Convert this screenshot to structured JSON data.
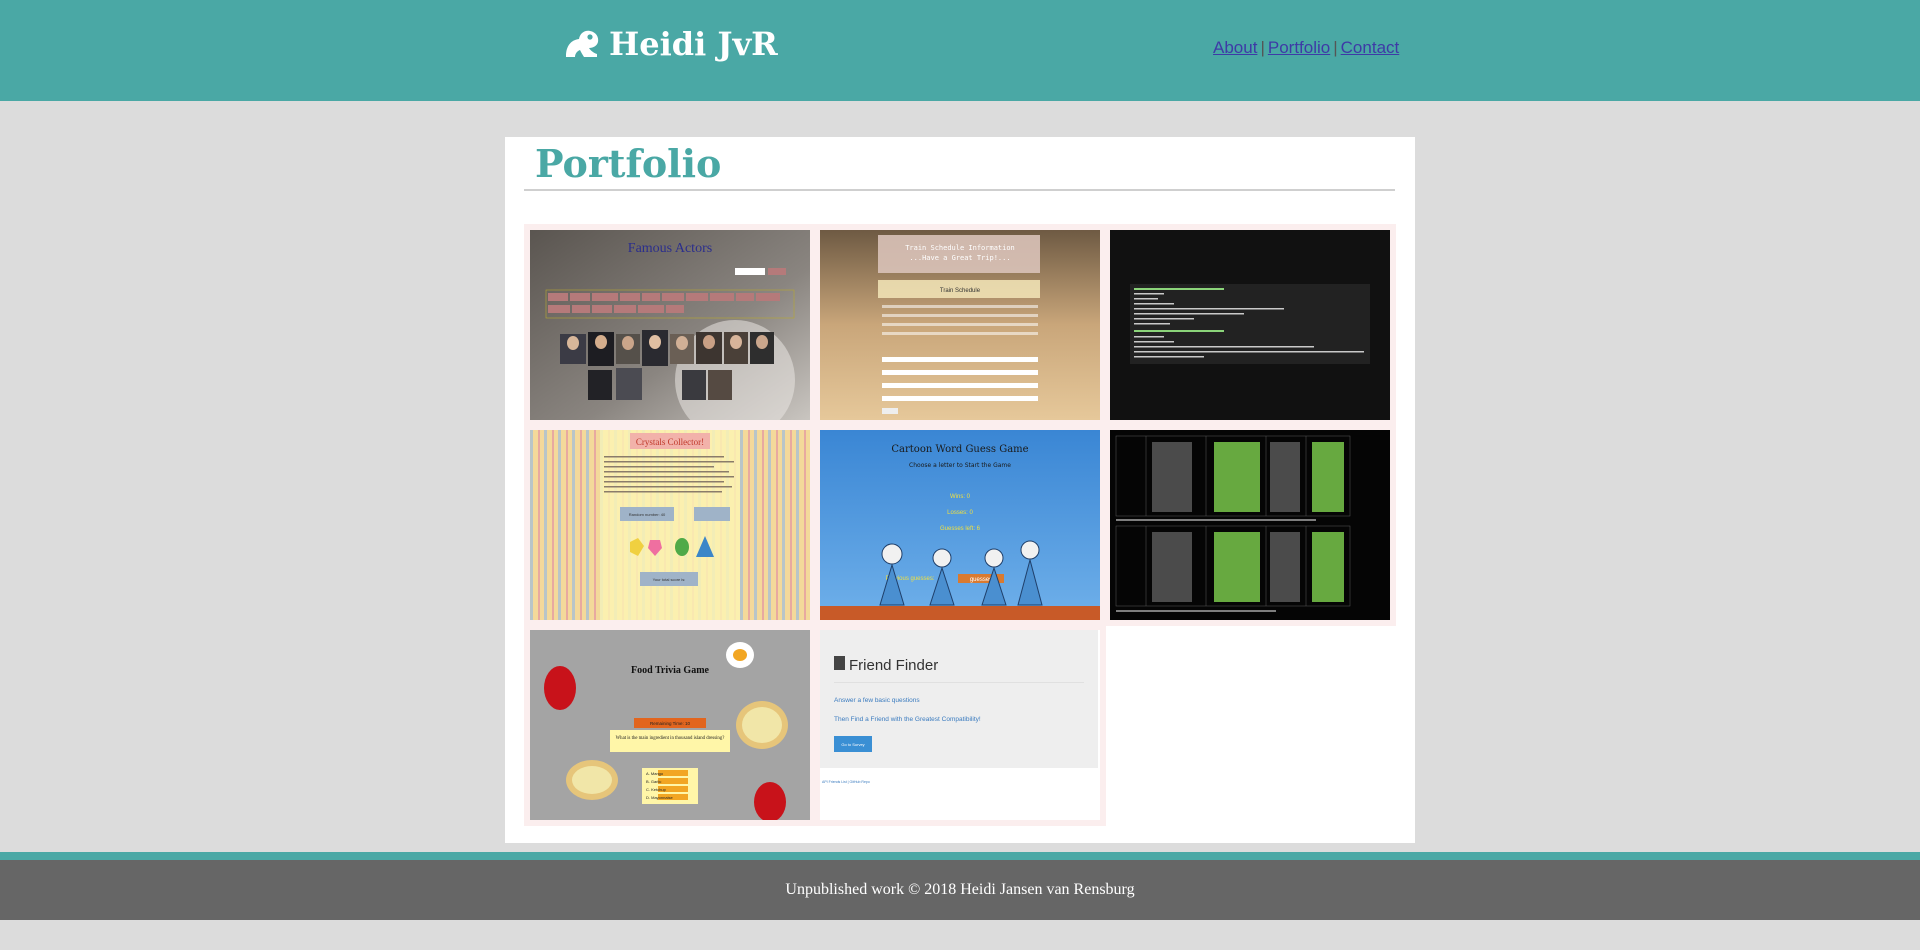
{
  "header": {
    "brand_name": "Heidi JvR",
    "brand_icon": "frog-icon",
    "nav": [
      {
        "label": "About"
      },
      {
        "label": "Portfolio"
      },
      {
        "label": "Contact"
      }
    ],
    "separator": "|"
  },
  "main": {
    "title": "Portfolio",
    "projects": [
      {
        "screenshot_text": [
          "Famous Actors"
        ]
      },
      {
        "screenshot_text": [
          "Train Schedule Information",
          "...Have a Great Trip!...",
          "Train Schedule"
        ]
      },
      {
        "screenshot_text": []
      },
      {
        "screenshot_text": [
          "Crystals Collector!",
          "Random number: 40",
          "Your total score is:"
        ]
      },
      {
        "screenshot_text": [
          "Cartoon Word Guess Game",
          "Choose a letter to Start the Game",
          "Wins: 0",
          "Losses: 0",
          "Guesses left: 6",
          "Previous guesses:",
          "guesses"
        ]
      },
      {
        "screenshot_text": []
      },
      {
        "screenshot_text": [
          "Food Trivia Game",
          "Remaining Time: 10",
          "What is the main ingredient in thousand island dressing?",
          "A. Mango",
          "B. Garlic",
          "C. Ketchup",
          "D. Mayonnaise"
        ]
      },
      {
        "screenshot_text": [
          "Friend Finder",
          "Answer a few basic questions",
          "Then Find a Friend with the Greatest Compatibility!",
          "Go to Survey",
          "API Friends List | GitHub Repo"
        ]
      }
    ]
  },
  "footer": {
    "text": "Unpublished work © 2018 Heidi Jansen van Rensburg"
  },
  "colors": {
    "teal": "#4aa8a5",
    "background": "#dcdcdc",
    "footer": "#666666",
    "link": "#3e3aa6"
  }
}
